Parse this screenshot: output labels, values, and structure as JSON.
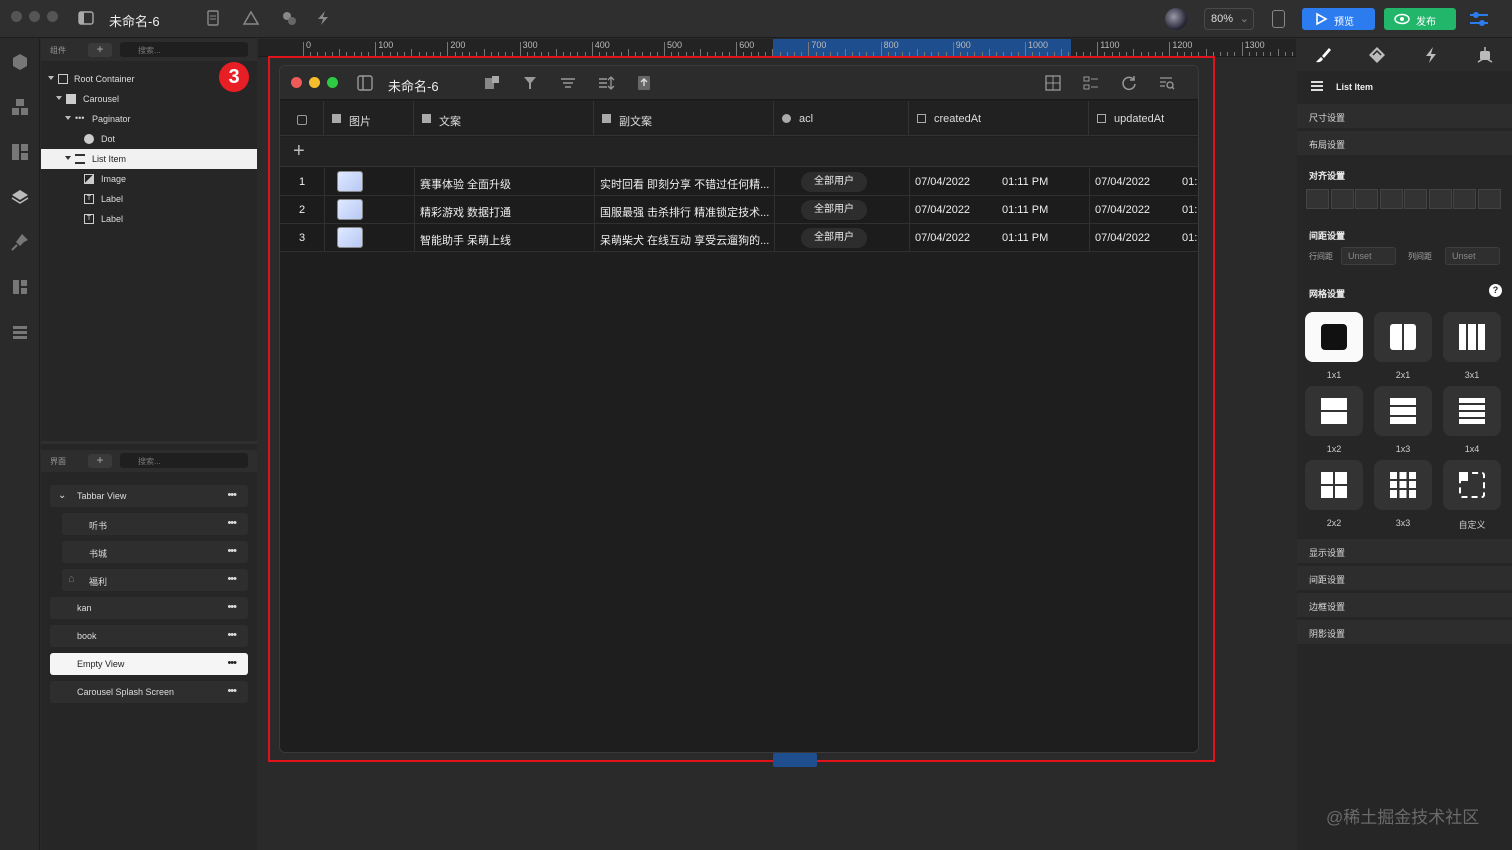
{
  "topbar": {
    "title": "未命名-6",
    "zoom": "80%",
    "preview_label": "预览",
    "publish_label": "发布"
  },
  "layers_panel": {
    "header_label": "组件",
    "search_placeholder": "搜索...",
    "tree": [
      {
        "label": "Root Container",
        "icon": "container-icon"
      },
      {
        "label": "Carousel",
        "icon": "carousel-icon"
      },
      {
        "label": "Paginator",
        "icon": "paginator-icon"
      },
      {
        "label": "Dot",
        "icon": "dot-icon"
      },
      {
        "label": "List Item",
        "icon": "list-item-icon"
      },
      {
        "label": "Image",
        "icon": "image-icon"
      },
      {
        "label": "Label",
        "icon": "text-icon"
      },
      {
        "label": "Label",
        "icon": "text-icon"
      }
    ]
  },
  "pages_panel": {
    "header_label": "界面",
    "search_placeholder": "搜索...",
    "pages": [
      "Tabbar View",
      "听书",
      "书城",
      "福利",
      "kan",
      "book",
      "Empty View",
      "Carousel Splash Screen"
    ]
  },
  "ruler": {
    "labels": [
      "0",
      "100",
      "200",
      "300",
      "400",
      "500",
      "600",
      "700",
      "800",
      "900",
      "1000",
      "1100",
      "1200",
      "1300"
    ]
  },
  "step_badge": "3",
  "app_window": {
    "title": "未命名-6",
    "columns": [
      "图片",
      "文案",
      "副文案",
      "acl",
      "createdAt",
      "updatedAt"
    ],
    "rows": [
      {
        "n": "1",
        "text": "赛事体验 全面升级",
        "subtext": "实时回看 即刻分享 不错过任何精...",
        "acl": "全部用户",
        "created_date": "07/04/2022",
        "created_time": "01:11 PM",
        "updated_date": "07/04/2022",
        "updated_time": "01:1"
      },
      {
        "n": "2",
        "text": "精彩游戏 数据打通",
        "subtext": "国服最强 击杀排行 精准锁定技术...",
        "acl": "全部用户",
        "created_date": "07/04/2022",
        "created_time": "01:11 PM",
        "updated_date": "07/04/2022",
        "updated_time": "01:1"
      },
      {
        "n": "3",
        "text": "智能助手 呆萌上线",
        "subtext": "呆萌柴犬 在线互动 享受云遛狗的...",
        "acl": "全部用户",
        "created_date": "07/04/2022",
        "created_time": "01:11 PM",
        "updated_date": "07/04/2022",
        "updated_time": "01:1"
      }
    ]
  },
  "right_panel": {
    "selected_component": "List Item",
    "sections_top": [
      "尺寸设置",
      "布局设置"
    ],
    "align_title": "对齐设置",
    "spacing_title": "间距设置",
    "row_gap_label": "行间距",
    "col_gap_label": "列间距",
    "unset_value": "Unset",
    "grid_title": "网格设置",
    "grid_options": [
      "1x1",
      "2x1",
      "3x1",
      "1x2",
      "1x3",
      "1x4",
      "2x2",
      "3x3",
      "自定义"
    ],
    "sections_bottom": [
      "显示设置",
      "间距设置",
      "边框设置",
      "阴影设置"
    ]
  },
  "watermark": "@稀土掘金技术社区"
}
